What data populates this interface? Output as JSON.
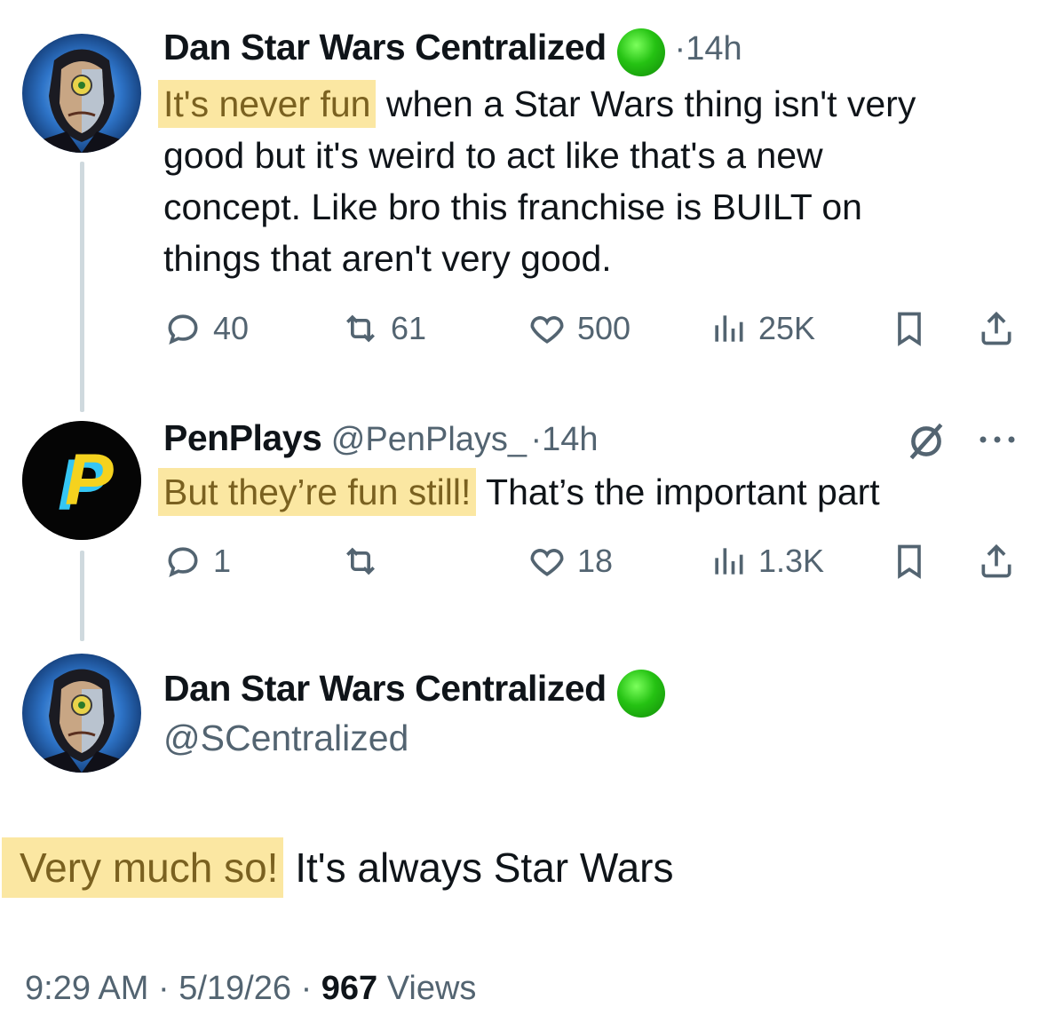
{
  "thread": {
    "tweet1": {
      "author_name": "Dan Star Wars Centralized",
      "time": "14h",
      "highlight": "It's never fun",
      "lines": [
        " when a Star Wars thing isn't very",
        "good but it's weird to act like that's a new",
        "concept. Like bro this franchise is BUILT on",
        "things that aren't very good."
      ],
      "stats": {
        "replies": "40",
        "reposts": "61",
        "likes": "500",
        "views": "25K"
      }
    },
    "tweet2": {
      "author_name": "PenPlays",
      "handle": "@PenPlays_",
      "time": "14h",
      "highlight": "But they’re fun still!",
      "rest": " That’s the important part",
      "stats": {
        "replies": "1",
        "reposts": "",
        "likes": "18",
        "views": "1.3K"
      }
    },
    "main": {
      "author_name": "Dan Star Wars Centralized",
      "handle": "@SCentralized",
      "highlight": "Very much so!",
      "rest": " It's always Star Wars",
      "footer": {
        "time": "9:29 AM",
        "date": "5/19/26",
        "views_count": "967",
        "views_label": "Views"
      }
    }
  },
  "icons": {
    "reply": "reply-icon",
    "repost": "repost-icon",
    "like": "like-icon",
    "views": "views-icon",
    "bookmark": "bookmark-icon",
    "share": "share-icon",
    "grok": "grok-icon",
    "more": "more-icon",
    "verified": "verified-badge-icon"
  },
  "colors": {
    "highlight_bg": "#fbe7a2",
    "highlight_text": "#7a6120",
    "muted": "#536471",
    "verified": "#25c213"
  }
}
